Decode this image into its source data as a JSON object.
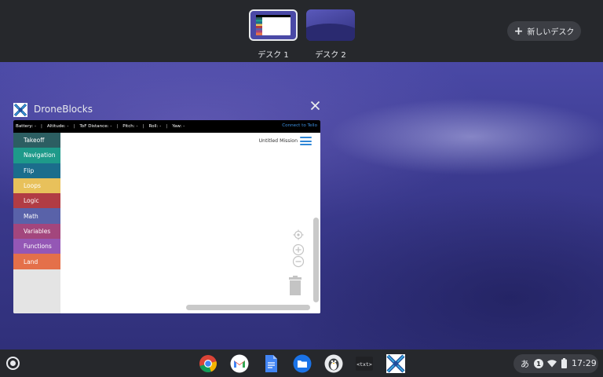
{
  "desks": [
    {
      "label": "デスク 1",
      "active": true
    },
    {
      "label": "デスク 2",
      "active": false
    }
  ],
  "new_desk": {
    "icon": "plus-icon",
    "label": "新しいデスク"
  },
  "window": {
    "title": "DroneBlocks",
    "close_icon": "close-icon",
    "status": {
      "battery": "Battery: -",
      "altitude": "Altitude: -",
      "tof": "ToF Distance: -",
      "pitch": "Pitch: -",
      "roll": "Roll: -",
      "yaw": "Yaw: -",
      "separator": "|",
      "connect": "Connect to Tello"
    },
    "categories": [
      {
        "label": "Takeoff",
        "color": "#2c5e62"
      },
      {
        "label": "Navigation",
        "color": "#1e9a8a"
      },
      {
        "label": "Flip",
        "color": "#1b6d8c"
      },
      {
        "label": "Loops",
        "color": "#e8c15b"
      },
      {
        "label": "Logic",
        "color": "#b13c44"
      },
      {
        "label": "Math",
        "color": "#5962a9"
      },
      {
        "label": "Variables",
        "color": "#a3467d"
      },
      {
        "label": "Functions",
        "color": "#9457b5"
      },
      {
        "label": "Land",
        "color": "#e4704a"
      }
    ],
    "mission_title": "Untitled Mission",
    "workspace_icons": [
      "recenter-icon",
      "zoom-in-icon",
      "zoom-out-icon",
      "trash-icon"
    ]
  },
  "shelf": {
    "apps": [
      "chrome-icon",
      "gmail-icon",
      "docs-icon",
      "files-icon",
      "linux-penguin-icon",
      "text-editor-icon",
      "droneblocks-icon"
    ],
    "tray": {
      "ime": "あ",
      "notification_count": "1",
      "time": "17:29"
    }
  }
}
